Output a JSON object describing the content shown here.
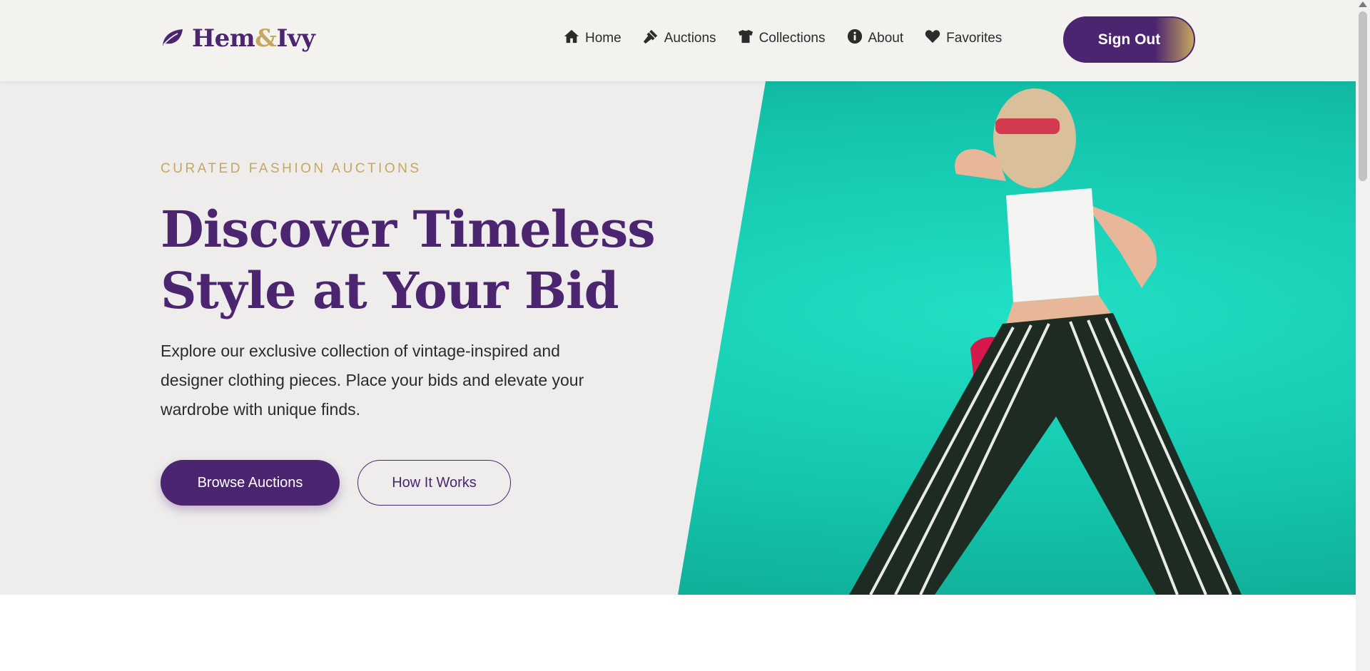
{
  "brand": {
    "name_part1": "Hem",
    "name_amp": "&",
    "name_part2": "Ivy",
    "logo_icon": "leaf-icon",
    "colors": {
      "primary": "#4b2570",
      "accent": "#c6a75f",
      "hero_bg": "#17c9b0"
    }
  },
  "nav": {
    "items": [
      {
        "label": "Home",
        "icon": "home-icon"
      },
      {
        "label": "Auctions",
        "icon": "gavel-icon"
      },
      {
        "label": "Collections",
        "icon": "shirt-icon"
      },
      {
        "label": "About",
        "icon": "info-icon"
      },
      {
        "label": "Favorites",
        "icon": "heart-icon"
      }
    ],
    "signout_label": "Sign Out"
  },
  "hero": {
    "eyebrow": "CURATED FASHION AUCTIONS",
    "headline": "Discover Timeless Style at Your Bid",
    "subtext": "Explore our exclusive collection of vintage-inspired and designer clothing pieces. Place your bids and elevate your wardrobe with unique finds.",
    "primary_button": "Browse Auctions",
    "secondary_button": "How It Works"
  }
}
